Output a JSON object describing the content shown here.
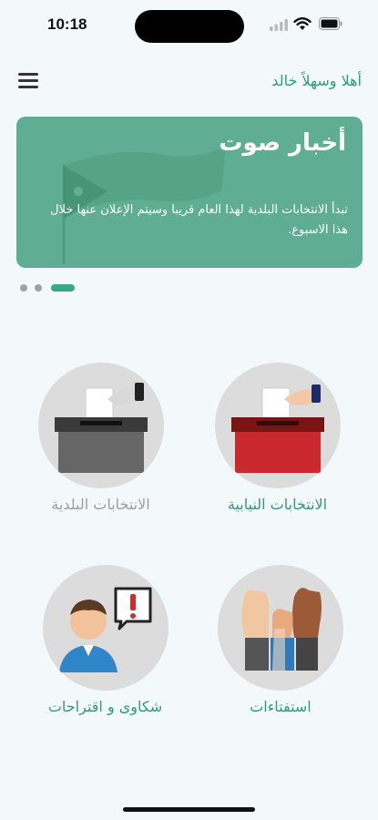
{
  "status_bar": {
    "time": "10:18"
  },
  "header": {
    "greeting": "أهلا وسهلاً خالد"
  },
  "banner": {
    "title": "أخبار صوت",
    "text": "تبدأ الانتخابات البلدية لهذا العام قريبا وسيتم الإعلان عنها خلال هذا الاسبوع.",
    "page_count": 3,
    "active_page": 3
  },
  "menu": {
    "parliamentary": {
      "label": "الانتخابات النيابية"
    },
    "municipal": {
      "label": "الانتخابات البلدية"
    },
    "polls": {
      "label": "استفتاءات"
    },
    "complaints": {
      "label": "شكاوى و اقتراحات"
    }
  },
  "colors": {
    "accent": "#2f9b7e",
    "banner": "#5fae93",
    "background": "#f3f9fb"
  }
}
